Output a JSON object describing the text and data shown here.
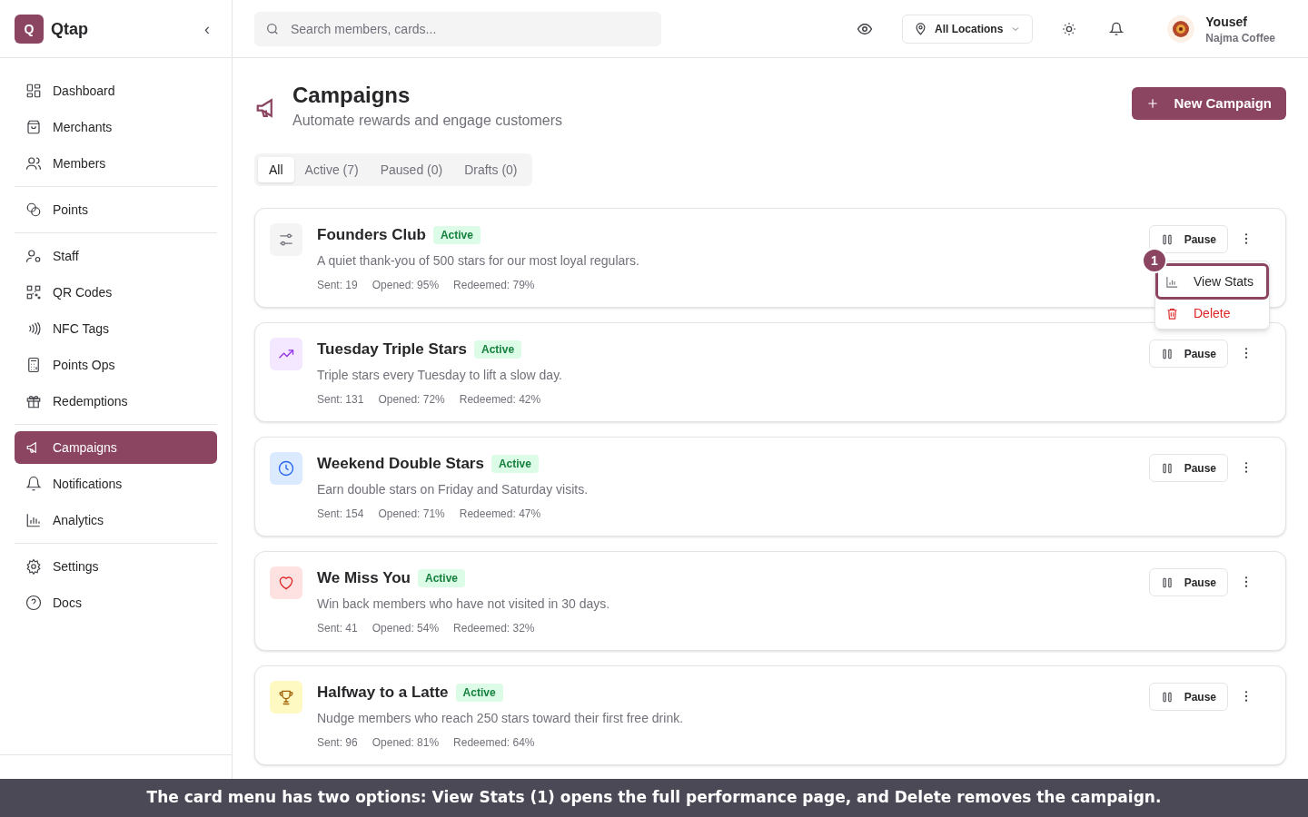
{
  "brand": {
    "logo": "Q",
    "name": "Qtap",
    "collapse": "‹"
  },
  "search": {
    "placeholder": "Search members, cards..."
  },
  "location": {
    "label": "All Locations"
  },
  "user": {
    "name": "Yousef",
    "org": "Najma Coffee"
  },
  "sidebar": {
    "groups": [
      [
        {
          "kind": "dashboard",
          "label": "Dashboard",
          "selected": false
        },
        {
          "kind": "bag",
          "label": "Merchants",
          "selected": false
        },
        {
          "kind": "users",
          "label": "Members",
          "selected": false
        }
      ],
      [
        {
          "kind": "coins",
          "label": "Points",
          "selected": false
        }
      ],
      [
        {
          "kind": "staff",
          "label": "Staff",
          "selected": false
        },
        {
          "kind": "qr",
          "label": "QR Codes",
          "selected": false
        },
        {
          "kind": "nfc",
          "label": "NFC Tags",
          "selected": false
        },
        {
          "kind": "calc",
          "label": "Points Ops",
          "selected": false
        },
        {
          "kind": "gift",
          "label": "Redemptions",
          "selected": false
        }
      ],
      [
        {
          "kind": "megaphone",
          "label": "Campaigns",
          "selected": true
        },
        {
          "kind": "bell",
          "label": "Notifications",
          "selected": false
        },
        {
          "kind": "chart",
          "label": "Analytics",
          "selected": false
        }
      ],
      [
        {
          "kind": "gear",
          "label": "Settings",
          "selected": false
        },
        {
          "kind": "help",
          "label": "Docs",
          "selected": false
        }
      ]
    ]
  },
  "page": {
    "title": "Campaigns",
    "subtitle": "Automate rewards and engage customers",
    "new_button": "New Campaign"
  },
  "tabs": [
    {
      "label": "All",
      "selected": true
    },
    {
      "label": "Active (7)",
      "selected": false
    },
    {
      "label": "Paused (0)",
      "selected": false
    },
    {
      "label": "Drafts (0)",
      "selected": false
    }
  ],
  "campaigns": [
    {
      "kind": "sliders",
      "name": "Founders Club",
      "status": "Active",
      "description": "A quiet thank-you of 500 stars for our most loyal regulars.",
      "stats": [
        "Sent: 19",
        "Opened: 95%",
        "Redeemed: 79%"
      ],
      "action": "Pause",
      "menu_open": true
    },
    {
      "kind": "trend",
      "name": "Tuesday Triple Stars",
      "status": "Active",
      "description": "Triple stars every Tuesday to lift a slow day.",
      "stats": [
        "Sent: 131",
        "Opened: 72%",
        "Redeemed: 42%"
      ],
      "action": "Pause",
      "menu_open": false
    },
    {
      "kind": "clock",
      "name": "Weekend Double Stars",
      "status": "Active",
      "description": "Earn double stars on Friday and Saturday visits.",
      "stats": [
        "Sent: 154",
        "Opened: 71%",
        "Redeemed: 47%"
      ],
      "action": "Pause",
      "menu_open": false
    },
    {
      "kind": "heart",
      "name": "We Miss You",
      "status": "Active",
      "description": "Win back members who have not visited in 30 days.",
      "stats": [
        "Sent: 41",
        "Opened: 54%",
        "Redeemed: 32%"
      ],
      "action": "Pause",
      "menu_open": false
    },
    {
      "kind": "trophy",
      "name": "Halfway to a Latte",
      "status": "Active",
      "description": "Nudge members who reach 250 stars toward their first free drink.",
      "stats": [
        "Sent: 96",
        "Opened: 81%",
        "Redeemed: 64%"
      ],
      "action": "Pause",
      "menu_open": false
    }
  ],
  "card_menu": {
    "items": [
      {
        "kind": "stats",
        "label": "View Stats",
        "selected": true
      },
      {
        "kind": "delete",
        "label": "Delete",
        "selected": false
      }
    ],
    "callout": "1"
  },
  "caption": "The card menu has two options: View Stats (1) opens the full performance page, and Delete removes the campaign."
}
